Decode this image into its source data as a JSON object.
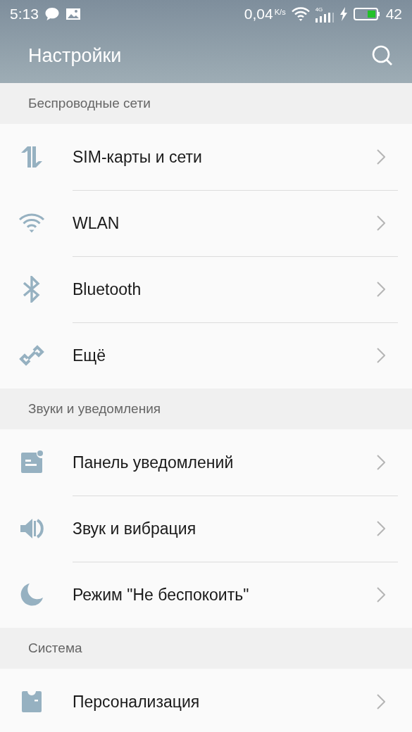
{
  "status_bar": {
    "time": "5:13",
    "speed": "0,04",
    "speed_unit": "K/s",
    "network": "4G",
    "battery": "42"
  },
  "toolbar": {
    "title": "Настройки"
  },
  "sections": [
    {
      "title": "Беспроводные сети",
      "items": [
        {
          "label": "SIM-карты и сети"
        },
        {
          "label": "WLAN"
        },
        {
          "label": "Bluetooth"
        },
        {
          "label": "Ещё"
        }
      ]
    },
    {
      "title": "Звуки и уведомления",
      "items": [
        {
          "label": "Панель уведомлений"
        },
        {
          "label": "Звук и вибрация"
        },
        {
          "label": "Режим \"Не беспокоить\""
        }
      ]
    },
    {
      "title": "Система",
      "items": [
        {
          "label": "Персонализация"
        }
      ]
    }
  ]
}
